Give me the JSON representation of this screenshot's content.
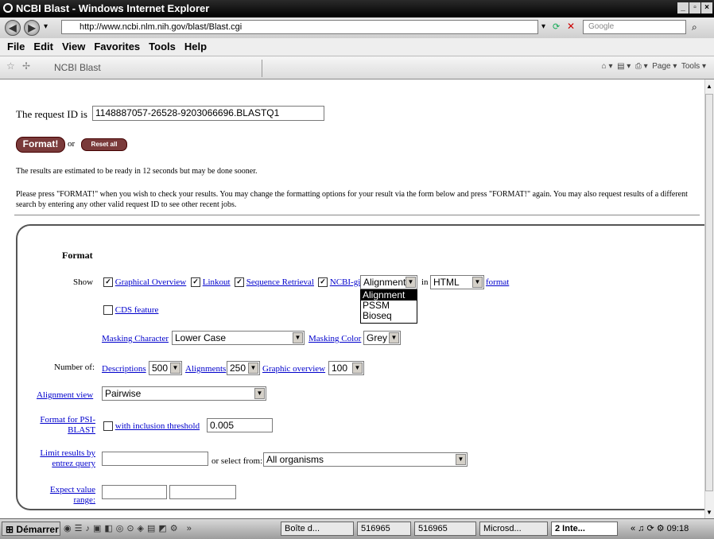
{
  "window": {
    "title": "NCBI Blast - Windows Internet Explorer"
  },
  "browser": {
    "url": "http://www.ncbi.nlm.nih.gov/blast/Blast.cgi",
    "search_placeholder": "Google",
    "menu": [
      "File",
      "Edit",
      "View",
      "Favorites",
      "Tools",
      "Help"
    ],
    "tab_title": "NCBI Blast",
    "toolbar_page": "Page",
    "toolbar_tools": "Tools"
  },
  "page": {
    "request_label": "The request ID is",
    "request_id": "1148887057-26528-9203066696.BLASTQ1",
    "format_button": "Format!",
    "or_text": "or",
    "reset_button": "Reset all",
    "estimate_text": "The results are estimated to be ready in 12 seconds but may be done sooner.",
    "instructions": "Please press \"FORMAT!\" when you wish to check your results. You may change the formatting options for your result via the form below and press \"FORMAT!\" again. You may also request results of a different search by entering any other valid request ID to see other recent jobs."
  },
  "form": {
    "heading": "Format",
    "show_label": "Show",
    "graphical_overview": "Graphical Overview",
    "linkout": "Linkout",
    "sequence_retrieval": "Sequence Retrieval",
    "ncbi_gi": "NCBI-gi",
    "alignment_select": "Alignment",
    "alignment_options": [
      "Alignment",
      "PSSM",
      "Bioseq"
    ],
    "in_text": "in",
    "format_select": "HTML",
    "format_text": "format",
    "cds_feature": "CDS feature",
    "masking_character_label": "Masking Character",
    "masking_character_value": "Lower Case",
    "masking_color_label": "Masking Color",
    "masking_color_value": "Grey",
    "number_of_label": "Number of:",
    "descriptions_label": "Descriptions",
    "descriptions_value": "500",
    "alignments_label": "Alignments",
    "alignments_value": "250",
    "graphic_overview_label": "Graphic overview",
    "graphic_overview_value": "100",
    "alignment_view_label": "Alignment view",
    "alignment_view_value": "Pairwise",
    "psi_label_1": "Format for PSI-",
    "psi_label_2": "BLAST",
    "inclusion_label": "with inclusion threshold",
    "inclusion_value": "0.005",
    "limit_label_1": "Limit results by",
    "limit_label_2": "entrez query",
    "select_from_text": "or select from:",
    "organism_value": "All organisms",
    "expect_label_1": "Expect value",
    "expect_label_2": "range:"
  },
  "taskbar": {
    "start": "Démarrer",
    "tasks": [
      "Boîte d...",
      "516965",
      "516965",
      "Microsd...",
      "2 Inte..."
    ],
    "clock": "09:18"
  }
}
